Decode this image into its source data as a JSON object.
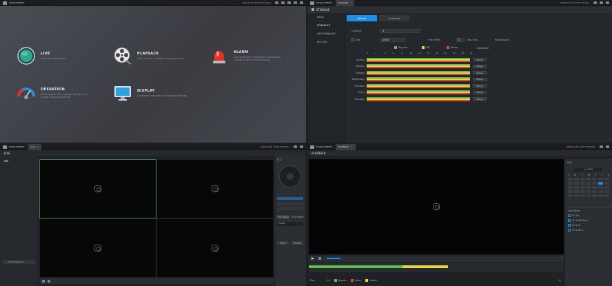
{
  "q1": {
    "window_title": "MANAGEMENT",
    "datetime": "2020-07-01 15:05:27 Friday",
    "tiles": [
      {
        "title": "LIVE",
        "desc": "View real-time video."
      },
      {
        "title": "PLAYBACK",
        "desc": "View, search, and play recorded videos."
      },
      {
        "title": "ALARM",
        "desc": "View and search the alarm information. Configure alarm event actions."
      },
      {
        "title": "OPERATION",
        "desc": "View System Info, System Update and Config import/export etc."
      },
      {
        "title": "DISPLAY",
        "desc": "Configure resolution and display settings."
      }
    ]
  },
  "q2": {
    "window_title": "MANAGEMENT",
    "tab": "STORAGE",
    "datetime": "2020-07-01 15:05:27 Friday",
    "header": "STORAGE",
    "sidebar": [
      "BASIC",
      "SCHEDULE",
      "HDD MANAGER",
      "RECORD"
    ],
    "tabs": [
      "Record",
      "Snapshot"
    ],
    "channel_label": "Channel",
    "channel_value": "1",
    "add_label": "Add",
    "add_value": "1000",
    "pre_event_label": "Pre-event",
    "pre_event_value": "4",
    "pre_event_unit": "sec. 60s",
    "redundancy_label": "Redundancy",
    "legend": [
      "Regular",
      "MD",
      "Alarm"
    ],
    "all_label": "All/Delete",
    "hours": [
      "0",
      "2",
      "4",
      "6",
      "8",
      "10",
      "12",
      "14",
      "16",
      "18",
      "20",
      "22",
      "24"
    ],
    "days": [
      "Sunday",
      "Monday",
      "Tuesday",
      "Wednesday",
      "Thursday",
      "Friday",
      "Saturday"
    ],
    "setting_label": "Setting",
    "colors": {
      "regular": "#5fbf4a",
      "md": "#e6d83a",
      "alarm": "#e0433a"
    }
  },
  "q3": {
    "window_title": "MANAGEMENT",
    "tab": "Live",
    "datetime": "2020-07-01 15:05:31 Friday",
    "header": "LIVE",
    "bottom_left": "Control Record",
    "ptz_title": "PTZ",
    "ptz_setup": "PTZ Setup",
    "ptz_preset": "PTZ Preset",
    "preset_value": "Preset",
    "btn_start": "Start",
    "btn_delete": "Delete"
  },
  "q4": {
    "window_title": "MANAGEMENT",
    "tab": "PLAYBACK",
    "datetime": "2020-07-01 15:07:18 Friday",
    "header": "PLAYBACK",
    "files_label": "Files",
    "month": "Jul 2020",
    "weekdays": [
      "S",
      "M",
      "T",
      "W",
      "T",
      "F",
      "S"
    ],
    "channels_label": "Cam Name",
    "channels": [
      "IP CH1",
      "CH 1080 Dev1",
      "CH 1 fs",
      "CH 2 DH 1"
    ],
    "legend": [
      "All",
      "Regular",
      "Alarm",
      "Motion"
    ],
    "time_label": "Play",
    "zoom": "1x"
  }
}
